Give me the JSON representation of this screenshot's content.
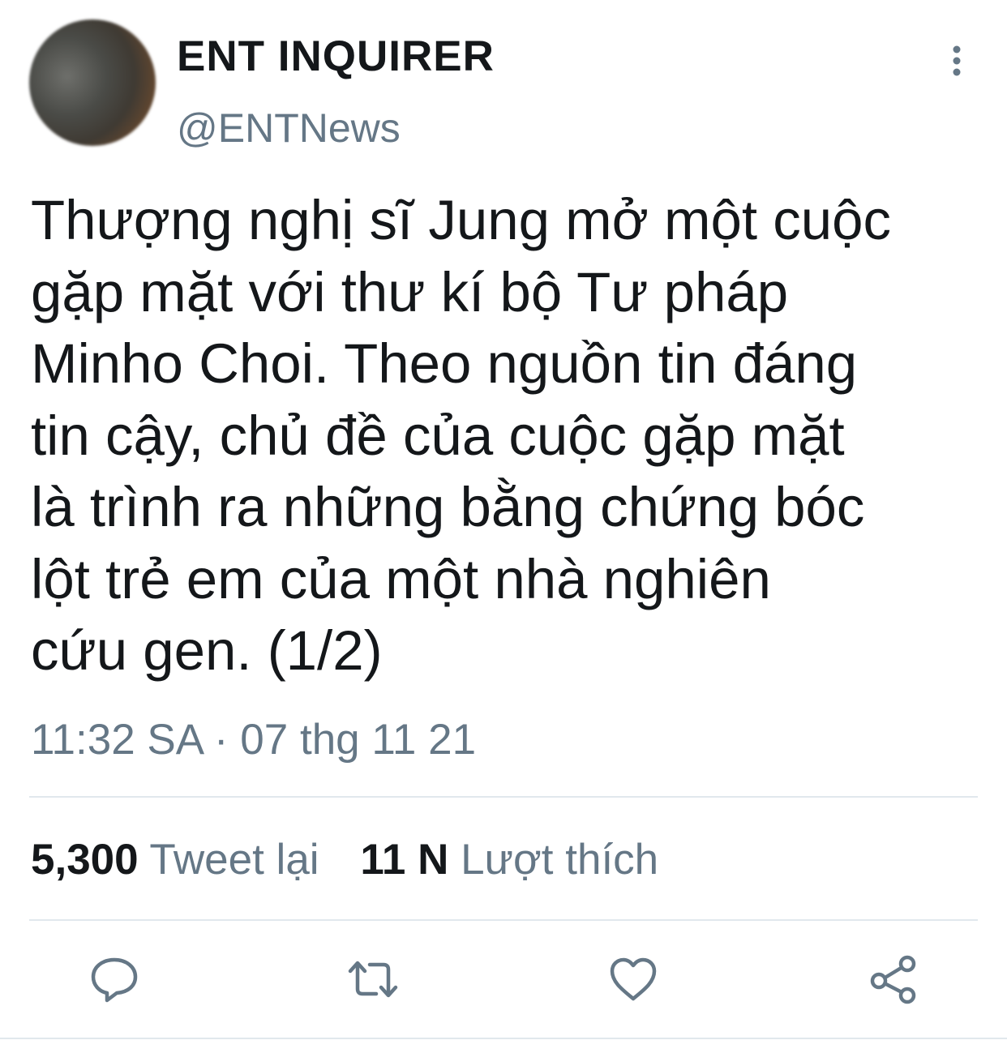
{
  "author": {
    "display_name": "ENT INQUIRER",
    "handle": "@ENTNews",
    "avatar": "blurred-avatar"
  },
  "tweet": {
    "text": "Thượng nghị sĩ Jung mở một cuộc\ngặp mặt với thư kí bộ Tư pháp\nMinho Choi. Theo nguồn tin đáng\ntin cậy, chủ đề của cuộc gặp mặt\nlà trình ra những bằng chứng bóc\nlột trẻ em của một nhà nghiên\ncứu gen. (1/2)",
    "timestamp": "11:32 SA · 07 thg 11 21"
  },
  "stats": {
    "retweets_count": "5,300",
    "retweets_label": "Tweet lại",
    "likes_count": "11 N",
    "likes_label": "Lượt thích"
  },
  "actions": {
    "icons": [
      "more-vertical-icon",
      "reply-icon",
      "retweet-icon",
      "like-icon",
      "share-icon"
    ]
  },
  "colors": {
    "text_primary": "#14171a",
    "text_secondary": "#657786",
    "icon": "#657786",
    "divider": "#e1e8ed"
  }
}
